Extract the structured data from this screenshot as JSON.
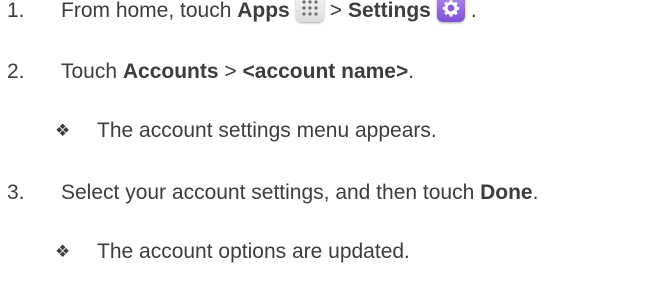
{
  "steps": [
    {
      "number": "1.",
      "text_a": "From home, touch ",
      "bold_a": "Apps",
      "sep": ">",
      "bold_b": "Settings",
      "end": "."
    },
    {
      "number": "2.",
      "text_a": "Touch ",
      "bold_a": "Accounts",
      "sep": " > ",
      "bold_b": "<account name>",
      "end": "."
    },
    {
      "number": "3.",
      "text_a": "Select your account settings, and then touch ",
      "bold_a": "Done",
      "end": "."
    }
  ],
  "notes": [
    {
      "bullet": "❖",
      "text": "The account settings menu appears."
    },
    {
      "bullet": "❖",
      "text": "The account options are updated."
    }
  ],
  "icons": {
    "apps": "apps-grid-icon",
    "settings": "settings-gear-icon",
    "settings_color": "#8a5ce0"
  }
}
